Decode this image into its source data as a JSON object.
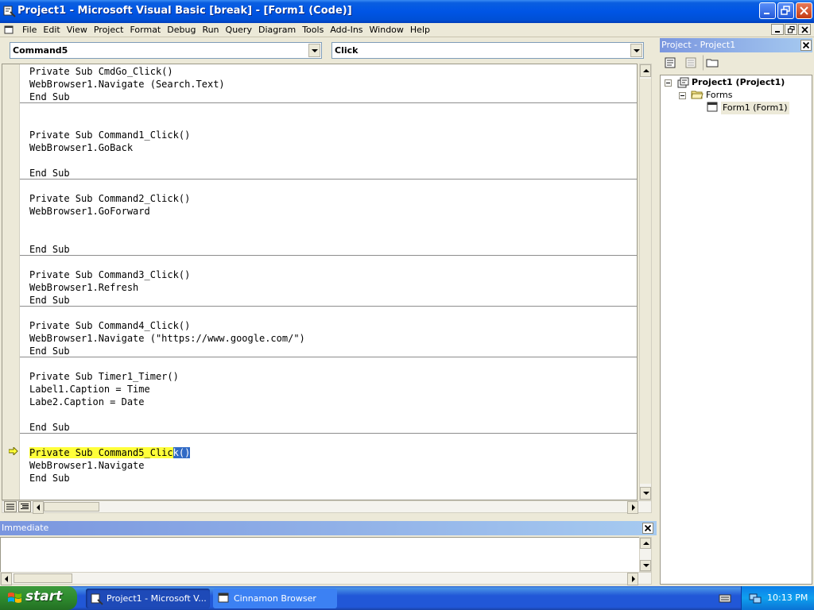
{
  "window": {
    "title": "Project1 - Microsoft Visual Basic [break] - [Form1 (Code)]"
  },
  "menu": {
    "items": [
      "File",
      "Edit",
      "View",
      "Project",
      "Format",
      "Debug",
      "Run",
      "Query",
      "Diagram",
      "Tools",
      "Add-Ins",
      "Window",
      "Help"
    ]
  },
  "code_window": {
    "object_combo": "Command5",
    "procedure_combo": "Click",
    "lines": [
      "Private Sub CmdGo_Click()",
      "WebBrowser1.Navigate (Search.Text)",
      "End Sub",
      "",
      "",
      "Private Sub Command1_Click()",
      "WebBrowser1.GoBack",
      "",
      "End Sub",
      "",
      "Private Sub Command2_Click()",
      "WebBrowser1.GoForward",
      "",
      "",
      "End Sub",
      "",
      "Private Sub Command3_Click()",
      "WebBrowser1.Refresh",
      "End Sub",
      "",
      "Private Sub Command4_Click()",
      "WebBrowser1.Navigate (\"https://www.google.com/\")",
      "End Sub",
      "",
      "Private Sub Timer1_Timer()",
      "Label1.Caption = Time",
      "Labe2.Caption = Date",
      "",
      "End Sub",
      "",
      "",
      "WebBrowser1.Navigate",
      "End Sub"
    ],
    "break_line": {
      "highlighted": "Private Sub Command5_Clic",
      "selected": "k()"
    }
  },
  "immediate": {
    "title": "Immediate"
  },
  "project_explorer": {
    "title": "Project - Project1",
    "tree": {
      "root": "Project1 (Project1)",
      "folder": "Forms",
      "form": "Form1 (Form1)"
    }
  },
  "taskbar": {
    "start_label": "start",
    "tasks": [
      "Project1 - Microsoft V...",
      "Cinnamon Browser"
    ],
    "clock": "10:13 PM"
  },
  "colors": {
    "title_bar": "#0055e5",
    "break_highlight": "#ffff3a",
    "selection": "#316ac5",
    "pane_title": "#7a96df",
    "start_button": "#2e8b2e"
  }
}
